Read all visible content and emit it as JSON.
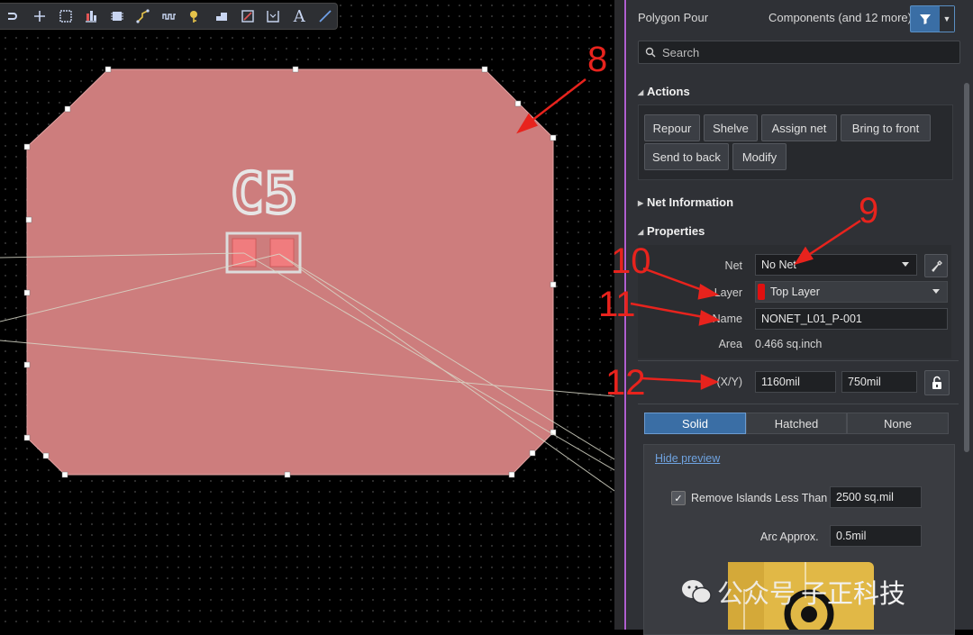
{
  "toolbar": {
    "icons": [
      "route-icon",
      "place-cross-icon",
      "select-rect-icon",
      "align-icon",
      "component-icon",
      "interactive-route-icon",
      "length-tune-icon",
      "keepout-icon",
      "polygon-icon",
      "fill-rect-icon",
      "dimension-icon",
      "text-icon",
      "line-icon"
    ],
    "text_glyph": "A"
  },
  "canvas": {
    "designator": "C5",
    "board_fill": "#cd7d7d",
    "pad_fill": "#f07c7e"
  },
  "panel": {
    "title": "Polygon Pour",
    "filter_text": "Components (and 12 more)",
    "search_placeholder": "Search",
    "actions": {
      "title": "Actions",
      "buttons": [
        "Repour",
        "Shelve",
        "Assign net",
        "Bring to front",
        "Send to back",
        "Modify"
      ]
    },
    "net_info": {
      "title": "Net Information"
    },
    "properties": {
      "title": "Properties",
      "net_label": "Net",
      "net_value": "No Net",
      "layer_label": "Layer",
      "layer_value": "Top Layer",
      "layer_color": "#e01010",
      "name_label": "Name",
      "name_value": "NONET_L01_P-001",
      "area_label": "Area",
      "area_value": "0.466 sq.inch",
      "xy_label": "(X/Y)",
      "x_value": "1160mil",
      "y_value": "750mil"
    },
    "fill_modes": [
      "Solid",
      "Hatched",
      "None"
    ],
    "fill_selected": "Solid",
    "preview": {
      "hide_preview": "Hide preview",
      "remove_islands_label": "Remove Islands Less Than",
      "remove_islands_checked": true,
      "remove_islands_value": "2500 sq.mil",
      "arc_label": "Arc Approx.",
      "arc_value": "0.5mil"
    }
  },
  "annotations": [
    "8",
    "9",
    "10",
    "11",
    "12"
  ],
  "watermark": {
    "prefix": "公众号",
    "name": "子正科技"
  },
  "colors": {
    "accent": "#3a6ea5",
    "annotation": "#e8231d"
  }
}
